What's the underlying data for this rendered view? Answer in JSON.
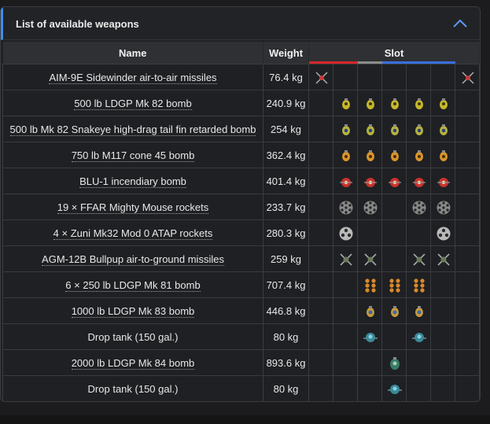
{
  "panel": {
    "title": "List of available weapons"
  },
  "table": {
    "headers": {
      "name": "Name",
      "weight": "Weight",
      "slot": "Slot"
    },
    "slot_bar_colors": [
      "#d6262c",
      "#d6262c",
      "#8c8c8c",
      "#3a6fe0",
      "#3a6fe0",
      "#3a6fe0"
    ],
    "rows": [
      {
        "name": "AIM-9E Sidewinder air-to-air missiles",
        "weight": "76.4 kg",
        "link": true,
        "icon": "missile-x-icon",
        "slots": [
          1,
          0,
          0,
          0,
          0,
          0,
          1
        ]
      },
      {
        "name": "500 lb LDGP Mk 82 bomb",
        "weight": "240.9 kg",
        "link": true,
        "icon": "yellow-bomb-icon",
        "slots": [
          0,
          1,
          1,
          1,
          1,
          1,
          0
        ]
      },
      {
        "name": "500 lb Mk 82 Snakeye high-drag tail fin retarded bomb",
        "weight": "254 kg",
        "link": true,
        "icon": "snakeye-bomb-icon",
        "slots": [
          0,
          1,
          1,
          1,
          1,
          1,
          0
        ]
      },
      {
        "name": "750 lb M117 cone 45 bomb",
        "weight": "362.4 kg",
        "link": true,
        "icon": "orange-bomb-icon",
        "slots": [
          0,
          1,
          1,
          1,
          1,
          1,
          0
        ]
      },
      {
        "name": "BLU-1 incendiary bomb",
        "weight": "401.4 kg",
        "link": true,
        "icon": "incendiary-bomb-icon",
        "slots": [
          0,
          1,
          1,
          1,
          1,
          1,
          0
        ]
      },
      {
        "name": "19 × FFAR Mighty Mouse rockets",
        "weight": "233.7 kg",
        "link": true,
        "icon": "rocket-pod-icon",
        "slots": [
          0,
          1,
          1,
          0,
          1,
          1,
          0
        ]
      },
      {
        "name": "4 × Zuni Mk32 Mod 0 ATAP rockets",
        "weight": "280.3 kg",
        "link": true,
        "icon": "zuni-pod-icon",
        "slots": [
          0,
          1,
          0,
          0,
          0,
          1,
          0
        ]
      },
      {
        "name": "AGM-12B Bullpup air-to-ground missiles",
        "weight": "259 kg",
        "link": true,
        "icon": "bullpup-missile-icon",
        "slots": [
          0,
          1,
          1,
          0,
          1,
          1,
          0
        ]
      },
      {
        "name": "6 × 250 lb LDGP Mk 81 bomb",
        "weight": "707.4 kg",
        "link": true,
        "icon": "bomb-cluster-icon",
        "slots": [
          0,
          0,
          1,
          1,
          1,
          0,
          0
        ]
      },
      {
        "name": "1000 lb LDGP Mk 83 bomb",
        "weight": "446.8 kg",
        "link": true,
        "icon": "blue-bomb-icon",
        "slots": [
          0,
          0,
          1,
          1,
          1,
          0,
          0
        ]
      },
      {
        "name": "Drop tank (150 gal.)",
        "weight": "80 kg",
        "link": false,
        "icon": "drop-tank-icon",
        "slots": [
          0,
          0,
          1,
          0,
          1,
          0,
          0
        ]
      },
      {
        "name": "2000 lb LDGP Mk 84 bomb",
        "weight": "893.6 kg",
        "link": true,
        "icon": "green-bomb-icon",
        "slots": [
          0,
          0,
          0,
          1,
          0,
          0,
          0
        ]
      },
      {
        "name": "Drop tank (150 gal.)",
        "weight": "80 kg",
        "link": false,
        "icon": "drop-tank-icon",
        "slots": [
          0,
          0,
          0,
          1,
          0,
          0,
          0
        ]
      }
    ]
  }
}
